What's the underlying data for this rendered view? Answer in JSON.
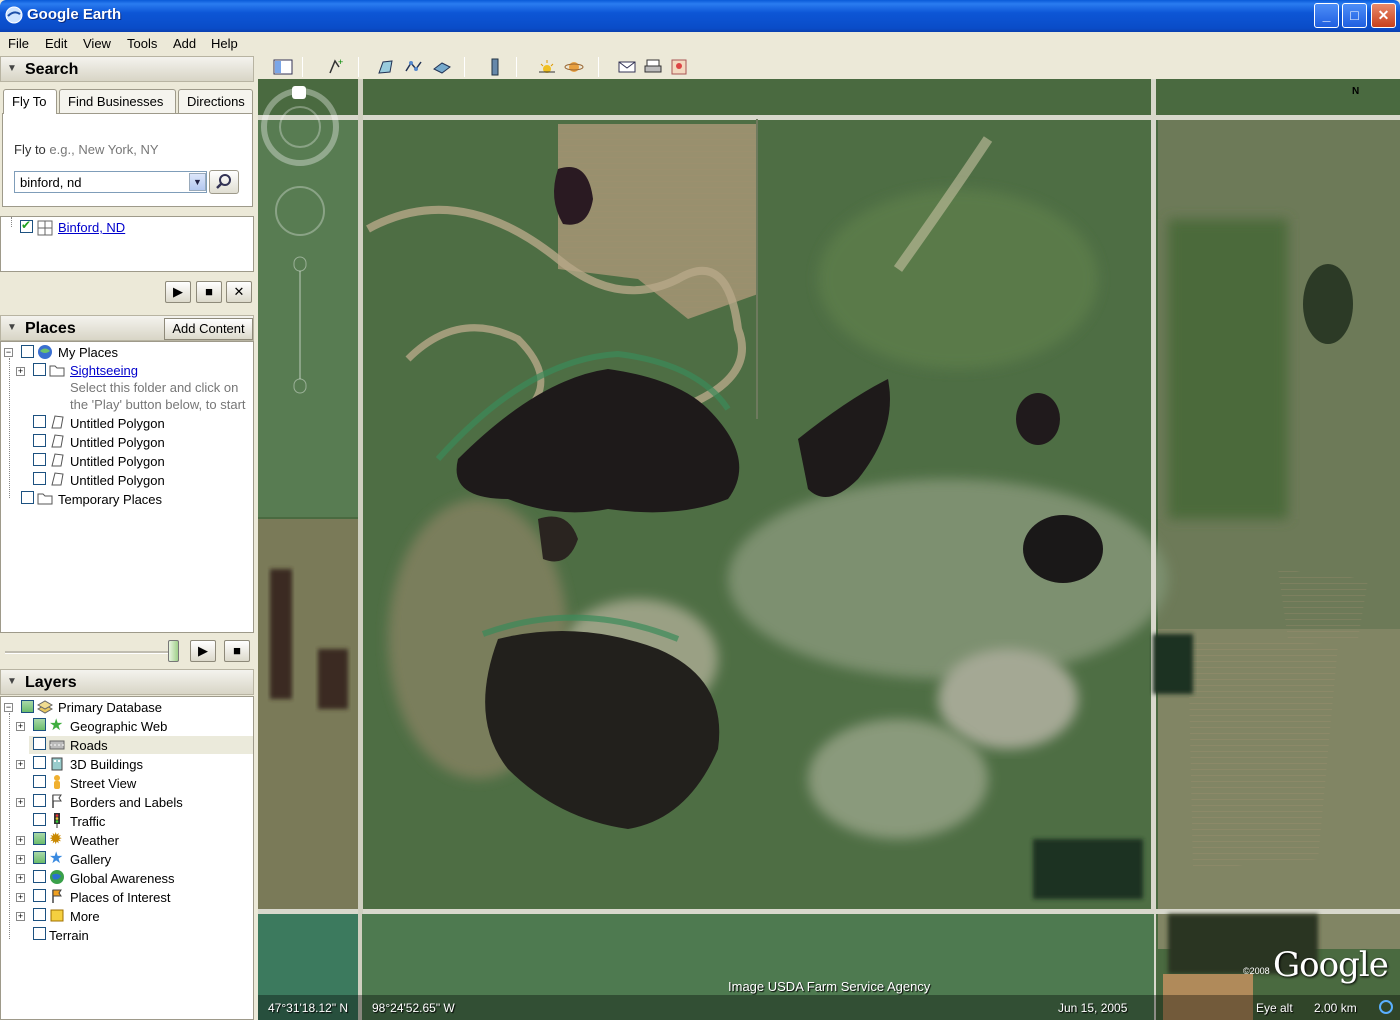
{
  "window": {
    "title": "Google Earth",
    "minimize": "_",
    "maximize": "□",
    "close": "✕"
  },
  "menu": [
    "File",
    "Edit",
    "View",
    "Tools",
    "Add",
    "Help"
  ],
  "search": {
    "header": "Search",
    "tabs": [
      "Fly To",
      "Find Businesses",
      "Directions"
    ],
    "fly_to_label": "Fly to",
    "fly_to_hint": "e.g., New York, NY",
    "query": "binford, nd",
    "results": [
      {
        "label": "Binford, ND",
        "checked": true
      }
    ]
  },
  "places": {
    "header": "Places",
    "add_content": "Add Content",
    "items": [
      {
        "label": "My Places",
        "level": 0
      },
      {
        "label": "Sightseeing",
        "level": 1,
        "link": true
      },
      {
        "label": "Select this folder and click on",
        "level": 1,
        "hint": true
      },
      {
        "label": "the 'Play' button below, to start",
        "level": 1,
        "hint": true
      },
      {
        "label": "Untitled Polygon",
        "level": 1
      },
      {
        "label": "Untitled Polygon",
        "level": 1
      },
      {
        "label": "Untitled Polygon",
        "level": 1
      },
      {
        "label": "Untitled Polygon",
        "level": 1
      },
      {
        "label": "Temporary Places",
        "level": 0
      }
    ]
  },
  "layers": {
    "header": "Layers",
    "items": [
      {
        "label": "Primary Database",
        "icon": "database-icon"
      },
      {
        "label": "Geographic Web",
        "icon": "star-icon"
      },
      {
        "label": "Roads",
        "icon": "road-icon"
      },
      {
        "label": "3D Buildings",
        "icon": "building-icon"
      },
      {
        "label": "Street View",
        "icon": "person-icon"
      },
      {
        "label": "Borders and Labels",
        "icon": "flag-icon"
      },
      {
        "label": "Traffic",
        "icon": "traffic-light-icon"
      },
      {
        "label": "Weather",
        "icon": "sun-icon"
      },
      {
        "label": "Gallery",
        "icon": "star-icon"
      },
      {
        "label": "Global Awareness",
        "icon": "globe-icon"
      },
      {
        "label": "Places of Interest",
        "icon": "flag-icon"
      },
      {
        "label": "More",
        "icon": "folder-icon"
      },
      {
        "label": "Terrain",
        "icon": ""
      }
    ]
  },
  "tour_controls": {
    "play": "▶",
    "stop": "■",
    "close": "✕"
  },
  "map": {
    "attribution": "Image USDA Farm Service Agency",
    "latitude": "47°31'18.12\" N",
    "longitude": "98°24'52.65\" W",
    "date": "Jun 15, 2005",
    "eye_alt_label": "Eye alt",
    "eye_alt_value": "2.00 km",
    "logo_small": "©2008",
    "logo": "Google",
    "compass_north": "N"
  },
  "colors": {
    "titlebar": "#0a56d6",
    "panel_bg": "#ece9d8",
    "link": "#0000cc"
  }
}
